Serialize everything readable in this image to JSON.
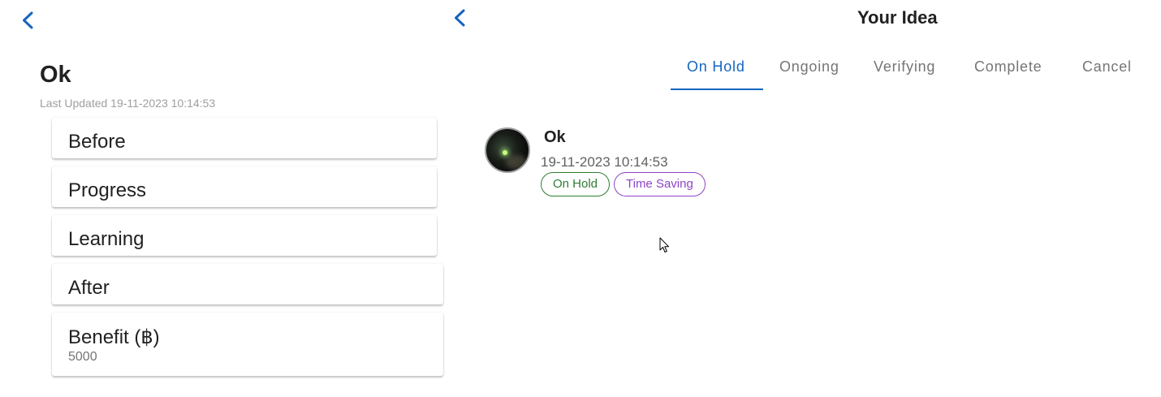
{
  "left_panel": {
    "title": "Ok",
    "last_updated": "Last Updated 19-11-2023 10:14:53",
    "sections": [
      {
        "label": "Before"
      },
      {
        "label": "Progress"
      },
      {
        "label": "Learning"
      },
      {
        "label": "After"
      },
      {
        "label": "Benefit (฿)",
        "value": "5000"
      }
    ]
  },
  "right_panel": {
    "title": "Your Idea",
    "tabs": [
      {
        "label": "On Hold",
        "active": true
      },
      {
        "label": "Ongoing",
        "active": false
      },
      {
        "label": "Verifying",
        "active": false
      },
      {
        "label": "Complete",
        "active": false
      },
      {
        "label": "Cancel",
        "active": false
      }
    ],
    "ideas": [
      {
        "title": "Ok",
        "date": "19-11-2023 10:14:53",
        "status_chip": "On Hold",
        "category_chip": "Time Saving"
      }
    ]
  },
  "icons": {
    "back_left": "chevron-left-icon",
    "back_right": "chevron-left-icon",
    "cursor": "mouse-pointer-icon"
  },
  "colors": {
    "accent": "#1565c0",
    "status_on_hold": "#2e7d32",
    "category_time_saving": "#8e44c7",
    "muted_text": "#9e9e9e"
  }
}
